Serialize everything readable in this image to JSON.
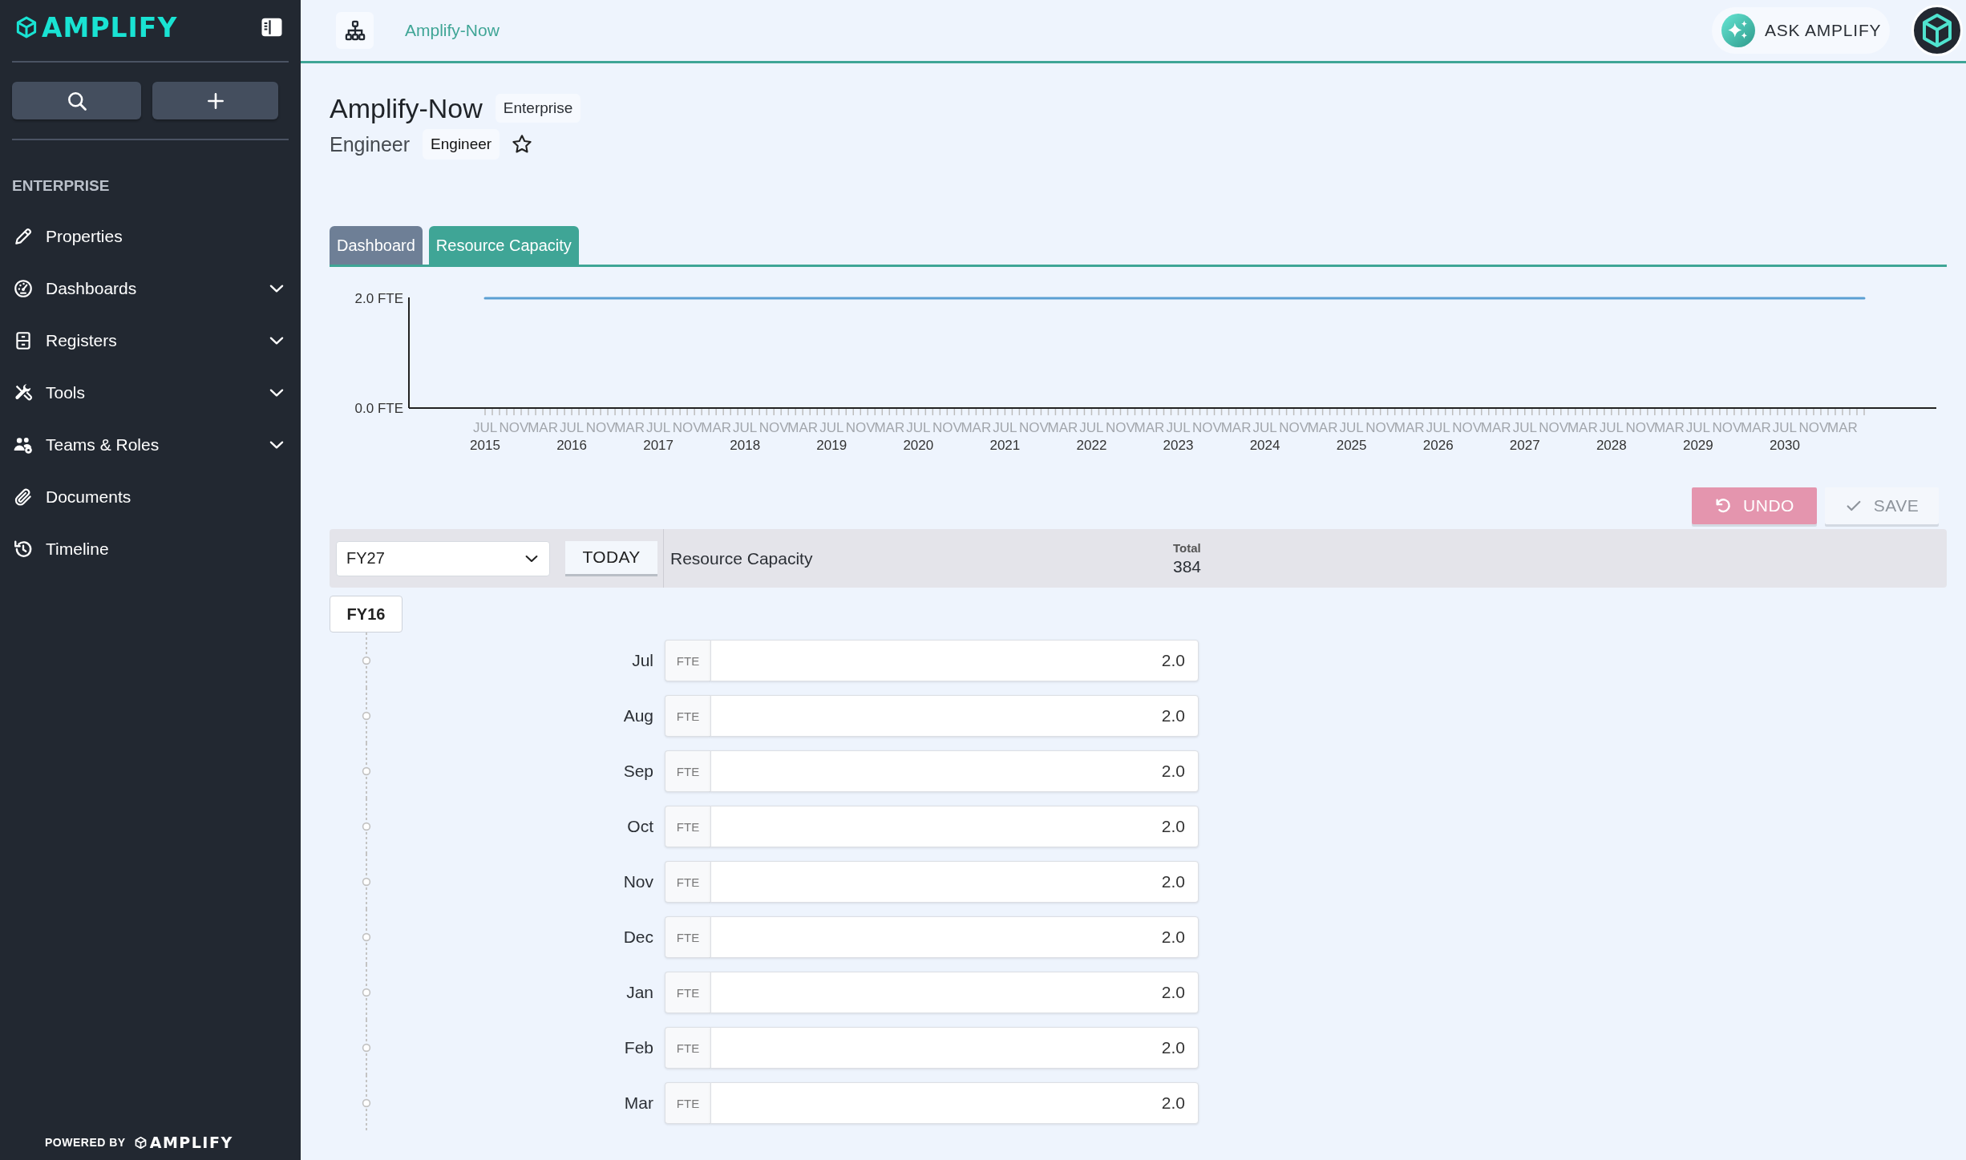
{
  "sidebar": {
    "logo": "AMPLIFY",
    "section": "ENTERPRISE",
    "items": [
      {
        "label": "Properties",
        "expandable": false,
        "selected": false
      },
      {
        "label": "Dashboards",
        "expandable": true,
        "selected": false
      },
      {
        "label": "Registers",
        "expandable": true,
        "selected": false
      },
      {
        "label": "Tools",
        "expandable": true,
        "selected": false
      },
      {
        "label": "Teams & Roles",
        "expandable": true,
        "selected": false
      },
      {
        "label": "Documents",
        "expandable": false,
        "selected": false
      },
      {
        "label": "Timeline",
        "expandable": false,
        "selected": false
      }
    ],
    "footer": {
      "text": "POWERED BY",
      "logo": "AMPLIFY"
    }
  },
  "topbar": {
    "breadcrumb": "Amplify-Now",
    "ask_button": "ASK AMPLIFY"
  },
  "header": {
    "title": "Amplify-Now",
    "title_tag": "Enterprise",
    "subtitle": "Engineer",
    "subtitle_tag": "Engineer",
    "favorite": false
  },
  "tabs": [
    {
      "label": "Dashboard",
      "selected": false
    },
    {
      "label": "Resource Capacity",
      "selected": true
    }
  ],
  "chart": {
    "year_labels": [
      "2015",
      "2016",
      "2017",
      "2018",
      "2019",
      "2020",
      "2021",
      "2022",
      "2023",
      "2024",
      "2025",
      "2026",
      "2027",
      "2028",
      "2029",
      "2030"
    ],
    "chart_data": {
      "type": "line",
      "ylim": [
        0,
        2
      ],
      "yticks": [
        {
          "value": 0,
          "label": "0.0 FTE"
        },
        {
          "value": 2,
          "label": "2.0 FTE"
        }
      ],
      "categories": [
        "JUL",
        null,
        null,
        null,
        "NOV",
        null,
        null,
        null,
        "MAR",
        null,
        null,
        null,
        "JUL",
        null,
        null,
        null,
        "NOV",
        null,
        null,
        null,
        "MAR",
        null,
        null,
        null,
        "JUL",
        null,
        null,
        null,
        "NOV",
        null,
        null,
        null,
        "MAR",
        null,
        null,
        null,
        "JUL",
        null,
        null,
        null,
        "NOV",
        null,
        null,
        null,
        "MAR",
        null,
        null,
        null,
        "JUL",
        null,
        null,
        null,
        "NOV",
        null,
        null,
        null,
        "MAR",
        null,
        null,
        null,
        "JUL",
        null,
        null,
        null,
        "NOV",
        null,
        null,
        null,
        "MAR",
        null,
        null,
        null,
        "JUL",
        null,
        null,
        null,
        "NOV",
        null,
        null,
        null,
        "MAR",
        null,
        null,
        null,
        "JUL",
        null,
        null,
        null,
        "NOV",
        null,
        null,
        null,
        "MAR",
        null,
        null,
        null,
        "JUL",
        null,
        null,
        null,
        "NOV",
        null,
        null,
        null,
        "MAR",
        null,
        null,
        null,
        "JUL",
        null,
        null,
        null,
        "NOV",
        null,
        null,
        null,
        "MAR",
        null,
        null,
        null,
        "JUL",
        null,
        null,
        null,
        "NOV",
        null,
        null,
        null,
        "MAR",
        null,
        null,
        null,
        "JUL",
        null,
        null,
        null,
        "NOV",
        null,
        null,
        null,
        "MAR",
        null,
        null,
        null,
        "JUL",
        null,
        null,
        null,
        "NOV",
        null,
        null,
        null,
        "MAR",
        null,
        null,
        null,
        "JUL",
        null,
        null,
        null,
        "NOV",
        null,
        null,
        null,
        "MAR",
        null,
        null,
        null,
        "JUL",
        null,
        null,
        null,
        "NOV",
        null,
        null,
        null,
        "MAR",
        null,
        null,
        null,
        "JUL",
        null,
        null,
        null,
        "NOV",
        null,
        null,
        null,
        "MAR",
        null,
        null,
        null
      ],
      "values": [
        2.0,
        2.0,
        2.0,
        2.0,
        2.0,
        2.0,
        2.0,
        2.0,
        2.0,
        2.0,
        2.0,
        2.0,
        2.0,
        2.0,
        2.0,
        2.0,
        2.0,
        2.0,
        2.0,
        2.0,
        2.0,
        2.0,
        2.0,
        2.0,
        2.0,
        2.0,
        2.0,
        2.0,
        2.0,
        2.0,
        2.0,
        2.0,
        2.0,
        2.0,
        2.0,
        2.0,
        2.0,
        2.0,
        2.0,
        2.0,
        2.0,
        2.0,
        2.0,
        2.0,
        2.0,
        2.0,
        2.0,
        2.0,
        2.0,
        2.0,
        2.0,
        2.0,
        2.0,
        2.0,
        2.0,
        2.0,
        2.0,
        2.0,
        2.0,
        2.0,
        2.0,
        2.0,
        2.0,
        2.0,
        2.0,
        2.0,
        2.0,
        2.0,
        2.0,
        2.0,
        2.0,
        2.0,
        2.0,
        2.0,
        2.0,
        2.0,
        2.0,
        2.0,
        2.0,
        2.0,
        2.0,
        2.0,
        2.0,
        2.0,
        2.0,
        2.0,
        2.0,
        2.0,
        2.0,
        2.0,
        2.0,
        2.0,
        2.0,
        2.0,
        2.0,
        2.0,
        2.0,
        2.0,
        2.0,
        2.0,
        2.0,
        2.0,
        2.0,
        2.0,
        2.0,
        2.0,
        2.0,
        2.0,
        2.0,
        2.0,
        2.0,
        2.0,
        2.0,
        2.0,
        2.0,
        2.0,
        2.0,
        2.0,
        2.0,
        2.0,
        2.0,
        2.0,
        2.0,
        2.0,
        2.0,
        2.0,
        2.0,
        2.0,
        2.0,
        2.0,
        2.0,
        2.0,
        2.0,
        2.0,
        2.0,
        2.0,
        2.0,
        2.0,
        2.0,
        2.0,
        2.0,
        2.0,
        2.0,
        2.0,
        2.0,
        2.0,
        2.0,
        2.0,
        2.0,
        2.0,
        2.0,
        2.0,
        2.0,
        2.0,
        2.0,
        2.0,
        2.0,
        2.0,
        2.0,
        2.0,
        2.0,
        2.0,
        2.0,
        2.0,
        2.0,
        2.0,
        2.0,
        2.0,
        2.0,
        2.0,
        2.0,
        2.0,
        2.0,
        2.0,
        2.0,
        2.0,
        2.0,
        2.0,
        2.0,
        2.0,
        2.0,
        2.0,
        2.0,
        2.0,
        2.0,
        2.0,
        2.0,
        2.0,
        2.0,
        2.0,
        2.0,
        2.0
      ]
    }
  },
  "actions": [
    {
      "kind": "undo",
      "label": "UNDO",
      "disabled": false
    },
    {
      "kind": "save",
      "label": "SAVE",
      "disabled": true
    }
  ],
  "capacity": {
    "period_select": {
      "value": "FY27"
    },
    "today_button": "TODAY",
    "row_label": "Resource Capacity",
    "total_label": "Total",
    "total": "384",
    "group": "FY16",
    "rows": [
      {
        "month": "Jul",
        "unit": "FTE",
        "value": "2.0"
      },
      {
        "month": "Aug",
        "unit": "FTE",
        "value": "2.0"
      },
      {
        "month": "Sep",
        "unit": "FTE",
        "value": "2.0"
      },
      {
        "month": "Oct",
        "unit": "FTE",
        "value": "2.0"
      },
      {
        "month": "Nov",
        "unit": "FTE",
        "value": "2.0"
      },
      {
        "month": "Dec",
        "unit": "FTE",
        "value": "2.0"
      },
      {
        "month": "Jan",
        "unit": "FTE",
        "value": "2.0"
      },
      {
        "month": "Feb",
        "unit": "FTE",
        "value": "2.0"
      },
      {
        "month": "Mar",
        "unit": "FTE",
        "value": "2.0"
      }
    ]
  }
}
